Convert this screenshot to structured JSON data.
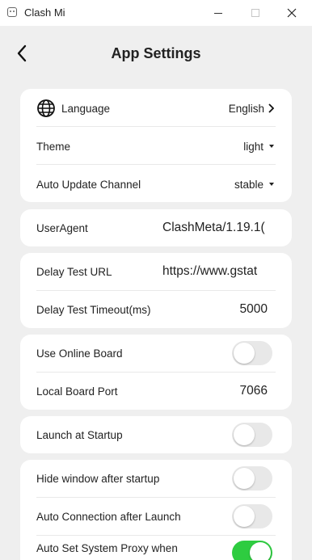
{
  "window": {
    "title": "Clash Mi"
  },
  "header": {
    "title": "App Settings"
  },
  "groups": {
    "general": {
      "language": {
        "label": "Language",
        "value": "English"
      },
      "theme": {
        "label": "Theme",
        "value": "light"
      },
      "update_channel": {
        "label": "Auto Update Channel",
        "value": "stable"
      }
    },
    "useragent": {
      "label": "UserAgent",
      "value": "ClashMeta/1.19.1("
    },
    "delay": {
      "url": {
        "label": "Delay Test URL",
        "value": "https://www.gstat"
      },
      "timeout": {
        "label": "Delay Test Timeout(ms)",
        "value": "5000"
      }
    },
    "board": {
      "online": {
        "label": "Use Online Board",
        "enabled": false
      },
      "port": {
        "label": "Local Board Port",
        "value": "7066"
      }
    },
    "startup": {
      "launch": {
        "label": "Launch at Startup",
        "enabled": false
      }
    },
    "window_opts": {
      "hide": {
        "label": "Hide window after startup",
        "enabled": false
      },
      "auto_connect": {
        "label": "Auto Connection after Launch",
        "enabled": false
      },
      "system_proxy": {
        "label": "Auto Set System Proxy when Connected",
        "enabled": true
      }
    }
  },
  "colors": {
    "toggle_on": "#2ecc40",
    "toggle_off": "#e8e8e8",
    "background": "#efefef",
    "card": "#ffffff"
  },
  "icons": {
    "back": "chevron-left-icon",
    "language": "globe-icon",
    "language_arrow": "chevron-right-icon",
    "dropdown": "caret-down-icon"
  }
}
